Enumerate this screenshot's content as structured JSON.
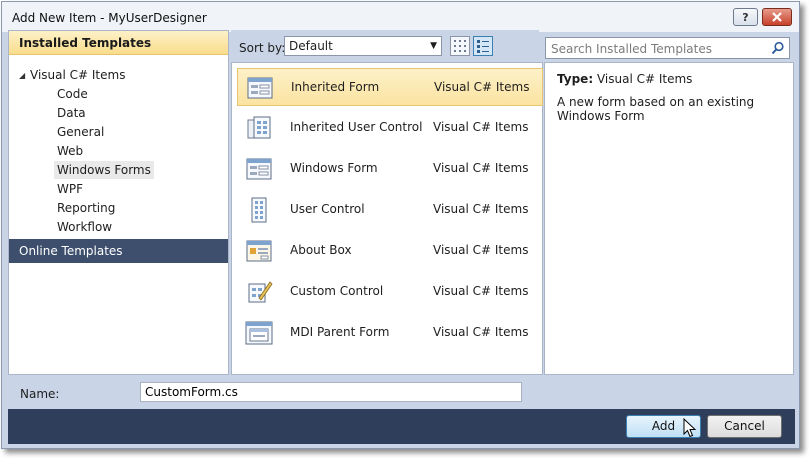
{
  "window": {
    "title": "Add New Item - MyUserDesigner"
  },
  "title_buttons": {
    "help": "?"
  },
  "left": {
    "header": "Installed Templates",
    "root": "Visual C# Items",
    "items": [
      "Code",
      "Data",
      "General",
      "Web",
      "Windows Forms",
      "WPF",
      "Reporting",
      "Workflow"
    ],
    "selected": "Windows Forms",
    "online": "Online Templates"
  },
  "sort": {
    "label": "Sort by:",
    "value": "Default"
  },
  "search": {
    "placeholder": "Search Installed Templates"
  },
  "templates": [
    {
      "name": "Inherited Form",
      "category": "Visual C# Items",
      "icon": "inherited-form-icon"
    },
    {
      "name": "Inherited User Control",
      "category": "Visual C# Items",
      "icon": "inherited-user-control-icon"
    },
    {
      "name": "Windows Form",
      "category": "Visual C# Items",
      "icon": "windows-form-icon"
    },
    {
      "name": "User Control",
      "category": "Visual C# Items",
      "icon": "user-control-icon"
    },
    {
      "name": "About Box",
      "category": "Visual C# Items",
      "icon": "about-box-icon"
    },
    {
      "name": "Custom Control",
      "category": "Visual C# Items",
      "icon": "custom-control-icon"
    },
    {
      "name": "MDI Parent Form",
      "category": "Visual C# Items",
      "icon": "mdi-parent-form-icon"
    }
  ],
  "details": {
    "type_label": "Type:",
    "type_value": "Visual C# Items",
    "description": "A new form based on an existing Windows Form"
  },
  "name_field": {
    "label": "Name:",
    "value": "CustomForm.cs"
  },
  "buttons": {
    "add": "Add",
    "cancel": "Cancel"
  },
  "colors": {
    "selection": "#fbe3a1",
    "footer": "#2f3e5b",
    "online_bar": "#3e4f6d",
    "dialog_bg": "#c9d5e6"
  }
}
